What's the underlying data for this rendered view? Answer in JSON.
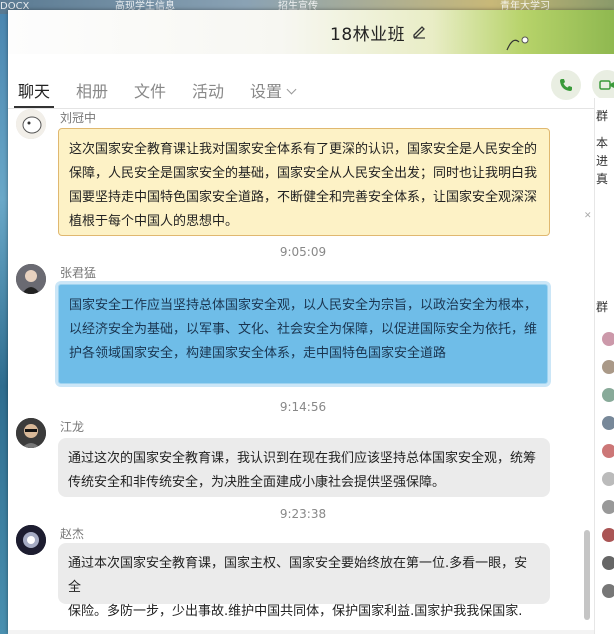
{
  "desktop": {
    "top_items": [
      "DOCX",
      "高现学生信息",
      "招生宣传",
      "青年大学习"
    ]
  },
  "window": {
    "title": "18林业班"
  },
  "tabs": [
    {
      "label": "聊天",
      "active": true
    },
    {
      "label": "相册",
      "active": false
    },
    {
      "label": "文件",
      "active": false
    },
    {
      "label": "活动",
      "active": false
    },
    {
      "label": "设置",
      "active": false
    }
  ],
  "colors": {
    "accent_green": "#3a9a3a",
    "yellow_bubble": "#fdf2c6",
    "blue_bubble": "#6fbde8",
    "gray_bubble": "#ebebeb"
  },
  "messages": [
    {
      "sender": "刘冠中",
      "lines": [
        "这次国家安全教育课让我对国家安全体系有了更深的认识，国家安全是人民安全的",
        "保障，人民安全是国家安全的基础，国家安全从人民安全出发；同时也让我明白我",
        "国要坚持走中国特色国家安全道路，不断健全和完善安全体系，让国家安全观深深",
        "植根于每个中国人的思想中。"
      ]
    },
    {
      "time": "9:05:09",
      "sender": "张君猛",
      "lines": [
        "国家安全工作应当坚持总体国家安全观，以人民安全为宗旨，以政治安全为根本，",
        "以经济安全为基础，以军事、文化、社会安全为保障，以促进国际安全为依托，维",
        "护各领域国家安全，构建国家安全体系，走中国特色国家安全道路"
      ]
    },
    {
      "time": "9:14:56",
      "sender": "江龙",
      "lines": [
        "通过这次的国家安全教育课，我认识到在现在我们应该坚持总体国家安全观，统筹",
        "传统安全和非传统安全，为决胜全面建成小康社会提供坚强保障。"
      ]
    },
    {
      "time": "9:23:38",
      "sender": "赵杰",
      "lines": [
        "通过本次国家安全教育课，国家主权、国家安全要始终放在第一位.多看一眼，安全",
        "保险。多防一步，少出事故.维护中国共同体，保护国家利益.国家护我我保国家."
      ]
    }
  ],
  "side_panel": {
    "heading1": "群",
    "lines": [
      "本",
      "进",
      "真"
    ],
    "heading2": "群"
  },
  "icons": {
    "edit": "pencil-icon",
    "voice_call": "phone-icon",
    "video_call": "video-icon"
  }
}
